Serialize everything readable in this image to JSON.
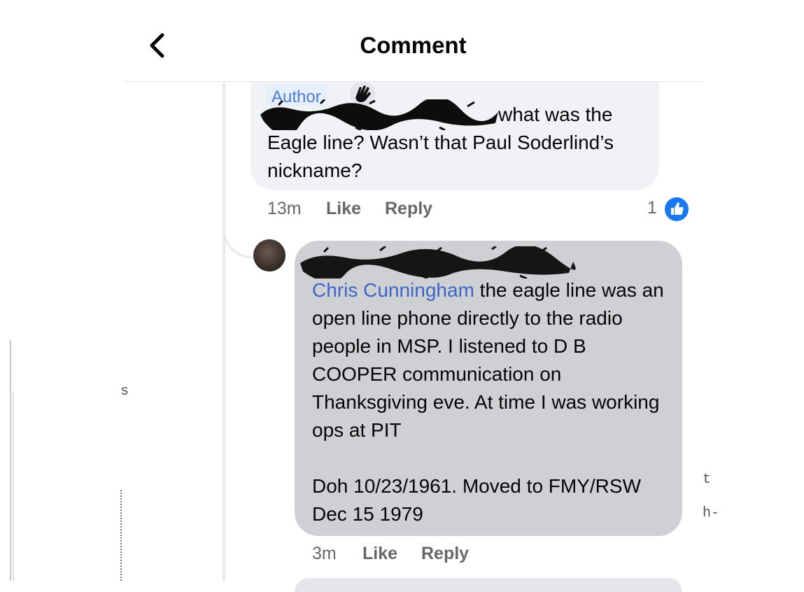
{
  "header": {
    "title": "Comment"
  },
  "comment1": {
    "badge": "Author",
    "text_tail": "what was the",
    "text_rest": "Eagle line? Wasn’t that Paul Soderlind’s nickname?",
    "time": "13m",
    "like_label": "Like",
    "reply_label": "Reply",
    "reaction_count": "1"
  },
  "comment2": {
    "mention": "Chris Cunningham",
    "text_after_mention": " the eagle line was an open line phone directly to the radio people in MSP. I listened to D B COOPER communication on Thanksgiving eve. At time I was working ops at PIT\n\nDoh 10/23/1961. Moved to FMY/RSW Dec 15 1979",
    "time": "3m",
    "like_label": "Like",
    "reply_label": "Reply"
  },
  "edge_marks": {
    "left1": "s",
    "right1": "t",
    "right2": "h-"
  },
  "colors": {
    "accent": "#1877f2",
    "mention": "#3b65c7",
    "bubble_primary": "#f0f2f5",
    "bubble_selected": "#cfd0d3"
  }
}
